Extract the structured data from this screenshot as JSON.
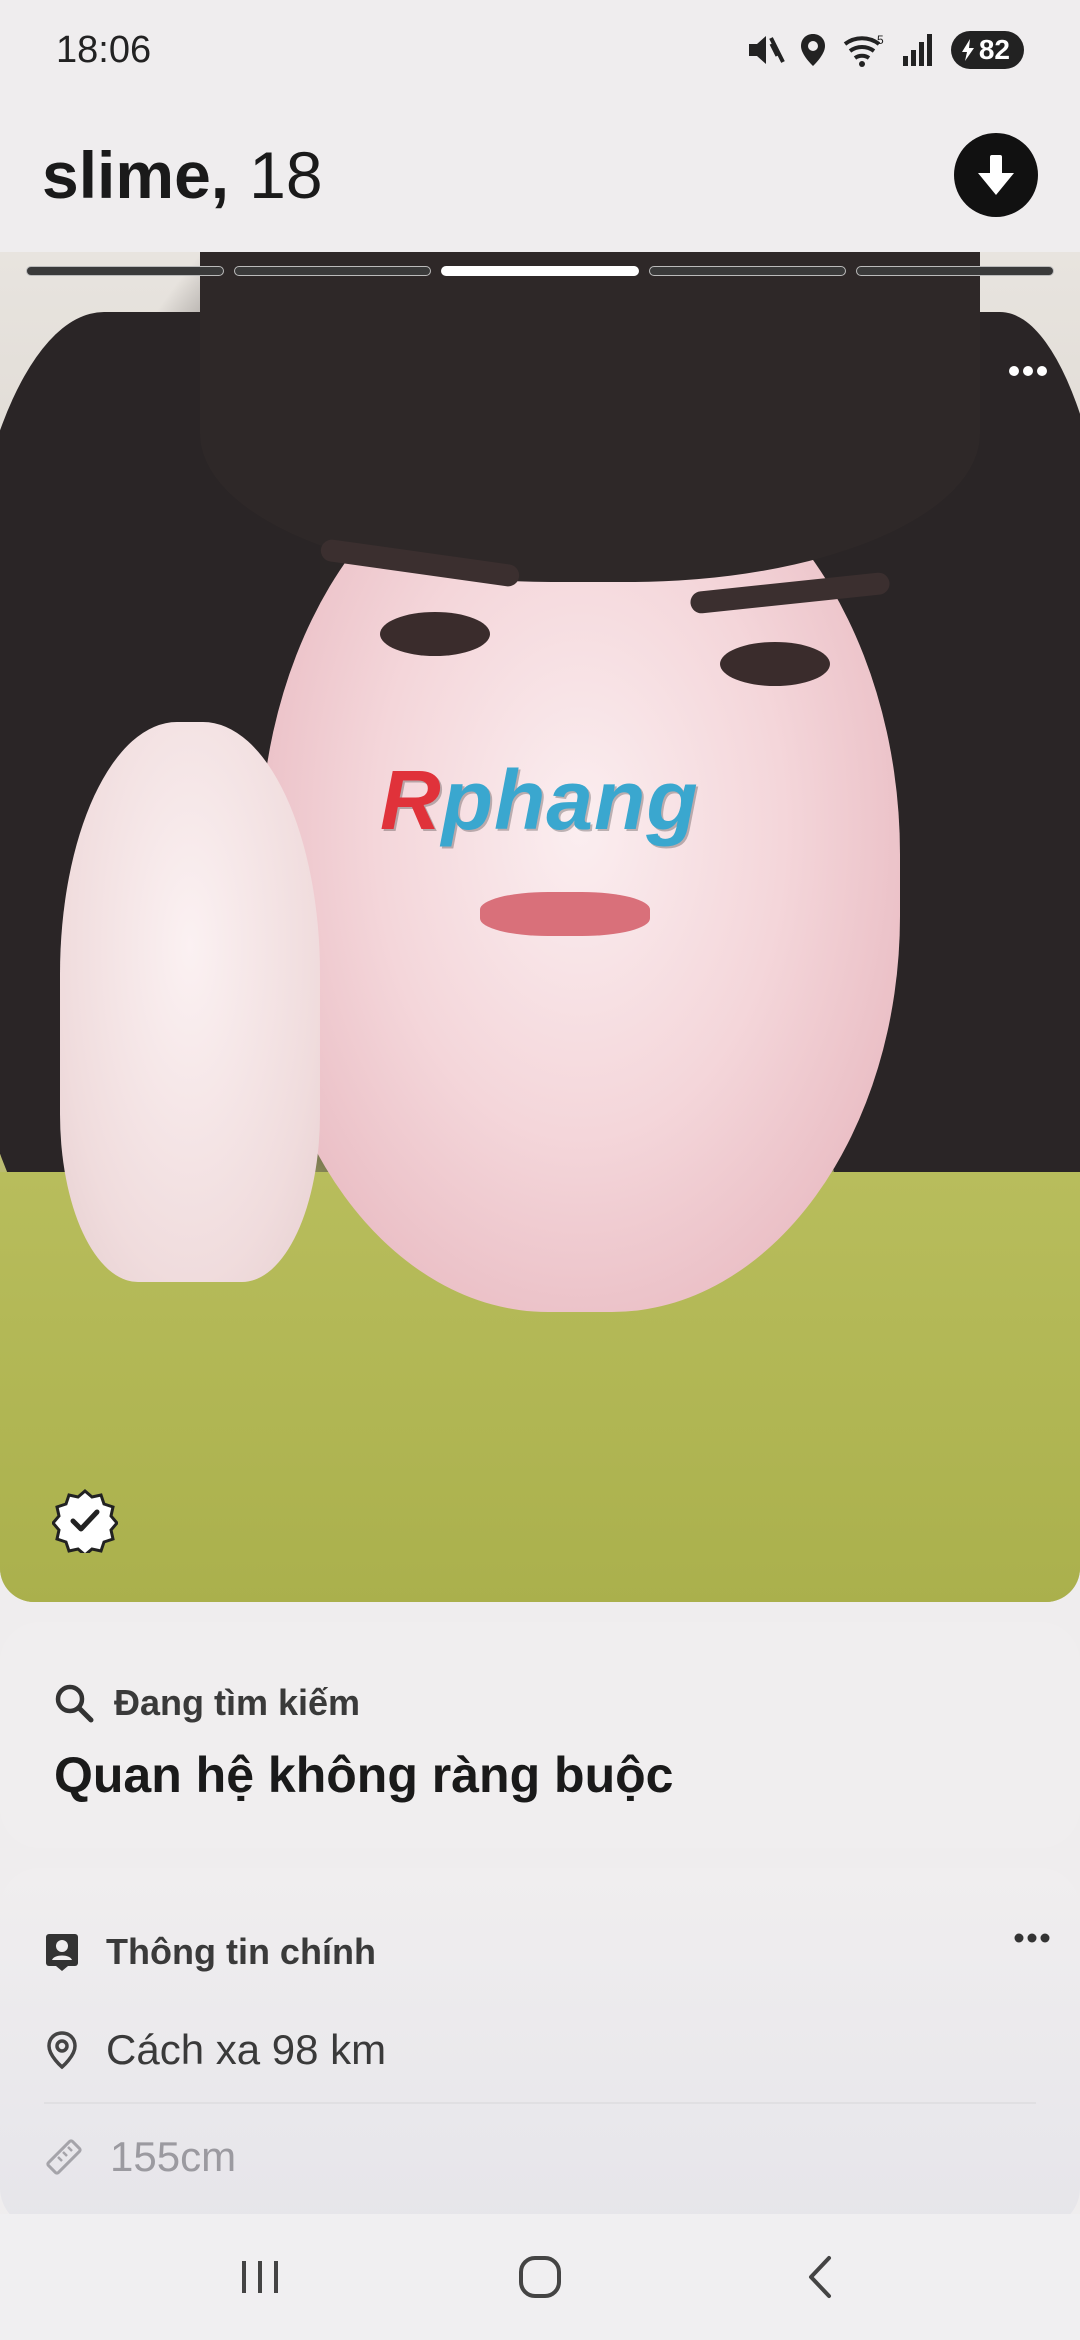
{
  "status": {
    "time": "18:06",
    "battery": "82"
  },
  "header": {
    "name": "slime,",
    "age": "18"
  },
  "photo": {
    "total_photos": 5,
    "active_photo_index": 3,
    "watermark_prefix": "R",
    "watermark_rest": "phang"
  },
  "search_card": {
    "label": "Đang tìm kiếm",
    "value": "Quan hệ không ràng buộc"
  },
  "info_card": {
    "title": "Thông tin chính",
    "distance": "Cách xa 98 km",
    "height": "155cm"
  },
  "icons": {
    "mute": "mute-icon",
    "location": "location-icon",
    "wifi": "wifi-icon",
    "signal": "signal-icon",
    "battery": "battery-icon",
    "download": "download-icon",
    "more": "more-horizontal-icon",
    "verified": "verified-badge-icon",
    "search": "search-icon",
    "profile": "profile-card-icon",
    "pin": "map-pin-icon",
    "ruler": "ruler-icon",
    "recents": "recents-icon",
    "home": "home-icon",
    "back": "back-icon"
  }
}
